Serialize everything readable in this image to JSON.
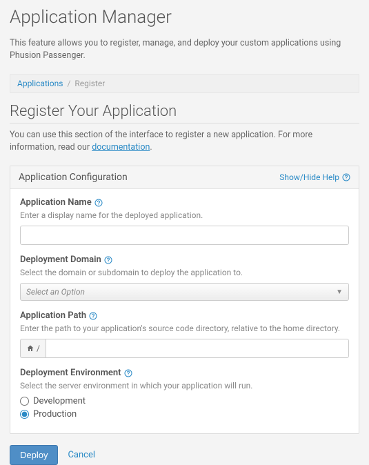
{
  "header": {
    "title": "Application Manager",
    "intro": "This feature allows you to register, manage, and deploy your custom applications using Phusion Passenger."
  },
  "breadcrumb": {
    "root": "Applications",
    "current": "Register"
  },
  "register": {
    "title": "Register Your Application",
    "desc_prefix": "You can use this section of the interface to register a new application. For more information, read our ",
    "desc_link": "documentation",
    "desc_suffix": "."
  },
  "panel": {
    "title": "Application Configuration",
    "show_hide": "Show/Hide Help"
  },
  "fields": {
    "name": {
      "label": "Application Name",
      "help": "Enter a display name for the deployed application.",
      "value": ""
    },
    "domain": {
      "label": "Deployment Domain",
      "help": "Select the domain or subdomain to deploy the application to.",
      "placeholder": "Select an Option"
    },
    "path": {
      "label": "Application Path",
      "help": "Enter the path to your application's source code directory, relative to the home directory.",
      "prefix": "/",
      "value": ""
    },
    "env": {
      "label": "Deployment Environment",
      "help": "Select the server environment in which your application will run.",
      "option_dev": "Development",
      "option_prod": "Production"
    }
  },
  "actions": {
    "deploy": "Deploy",
    "cancel": "Cancel"
  }
}
